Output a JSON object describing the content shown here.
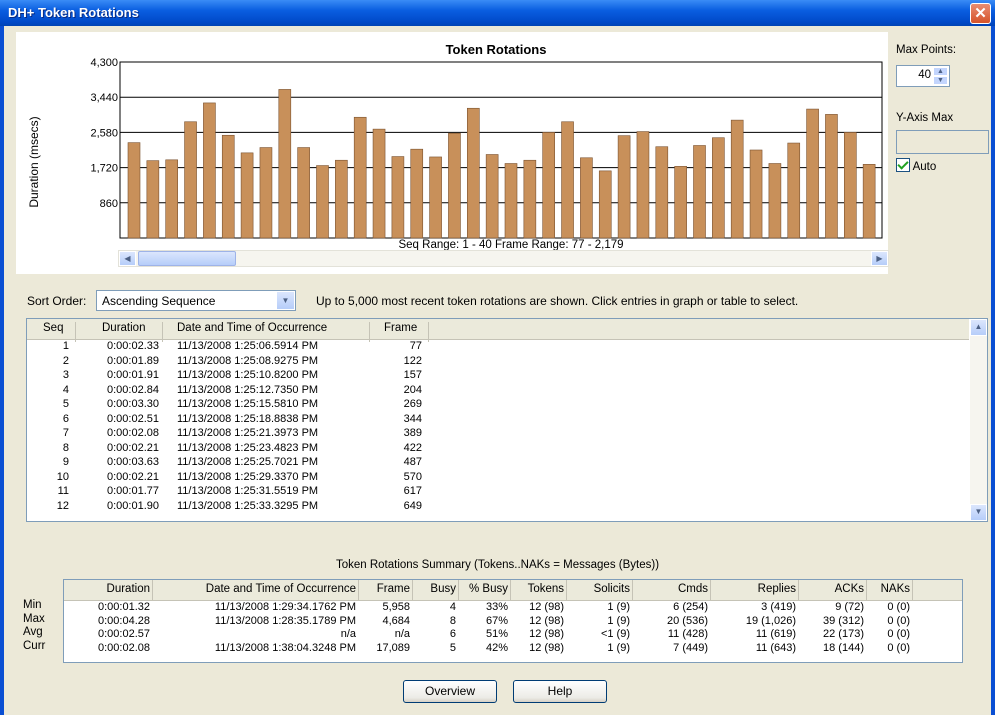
{
  "window": {
    "title": "DH+ Token Rotations",
    "close_glyph": "✕"
  },
  "chart_data": {
    "type": "bar",
    "title": "Token Rotations",
    "ylabel": "Duration (msecs)",
    "xlabel": "",
    "ylim": [
      0,
      4300
    ],
    "yticks": [
      "860",
      "1,720",
      "2,580",
      "3,440",
      "4,300"
    ],
    "ytick_values": [
      860,
      1720,
      2580,
      3440,
      4300
    ],
    "categories": [
      1,
      2,
      3,
      4,
      5,
      6,
      7,
      8,
      9,
      10,
      11,
      12,
      13,
      14,
      15,
      16,
      17,
      18,
      19,
      20,
      21,
      22,
      23,
      24,
      25,
      26,
      27,
      28,
      29,
      30,
      31,
      32,
      33,
      34,
      35,
      36,
      37,
      38,
      39,
      40
    ],
    "values": [
      2330,
      1890,
      1910,
      2840,
      3300,
      2510,
      2080,
      2210,
      3630,
      2210,
      1770,
      1900,
      2950,
      2660,
      1990,
      2170,
      1980,
      2560,
      3170,
      2040,
      1820,
      1900,
      2580,
      2840,
      1960,
      1640,
      2500,
      2600,
      2230,
      1750,
      2260,
      2450,
      2880,
      2150,
      1820,
      2320,
      3150,
      3020,
      2580,
      1800
    ],
    "grid": true,
    "bar_color": "#c8905a",
    "range_label": "Seq Range:  1 - 40     Frame Range:  77 - 2,179"
  },
  "controls": {
    "max_points_label": "Max Points:",
    "max_points_value": "40",
    "y_axis_max_label": "Y-Axis Max",
    "y_axis_max_value": "",
    "auto_label": "Auto",
    "auto_checked": true
  },
  "sort": {
    "label": "Sort Order:",
    "value": "Ascending Sequence",
    "note": "Up to 5,000 most recent token rotations are shown.  Click entries in graph or table to select."
  },
  "rotations_table": {
    "headers": [
      "Seq",
      "Duration",
      "Date and Time of Occurrence",
      "Frame"
    ],
    "rows": [
      [
        "1",
        "0:00:02.33",
        "11/13/2008 1:25:06.5914 PM",
        "77"
      ],
      [
        "2",
        "0:00:01.89",
        "11/13/2008 1:25:08.9275 PM",
        "122"
      ],
      [
        "3",
        "0:00:01.91",
        "11/13/2008 1:25:10.8200 PM",
        "157"
      ],
      [
        "4",
        "0:00:02.84",
        "11/13/2008 1:25:12.7350 PM",
        "204"
      ],
      [
        "5",
        "0:00:03.30",
        "11/13/2008 1:25:15.5810 PM",
        "269"
      ],
      [
        "6",
        "0:00:02.51",
        "11/13/2008 1:25:18.8838 PM",
        "344"
      ],
      [
        "7",
        "0:00:02.08",
        "11/13/2008 1:25:21.3973 PM",
        "389"
      ],
      [
        "8",
        "0:00:02.21",
        "11/13/2008 1:25:23.4823 PM",
        "422"
      ],
      [
        "9",
        "0:00:03.63",
        "11/13/2008 1:25:25.7021 PM",
        "487"
      ],
      [
        "10",
        "0:00:02.21",
        "11/13/2008 1:25:29.3370 PM",
        "570"
      ],
      [
        "11",
        "0:00:01.77",
        "11/13/2008 1:25:31.5519 PM",
        "617"
      ],
      [
        "12",
        "0:00:01.90",
        "11/13/2008 1:25:33.3295 PM",
        "649"
      ]
    ]
  },
  "summary": {
    "title": "Token Rotations Summary   (Tokens..NAKs = Messages (Bytes))",
    "headers": [
      "Duration",
      "Date and Time of Occurrence",
      "Frame",
      "Busy",
      "% Busy",
      "Tokens",
      "Solicits",
      "Cmds",
      "Replies",
      "ACKs",
      "NAKs"
    ],
    "rows": [
      {
        "label": "Min",
        "cells": [
          "0:00:01.32",
          "11/13/2008 1:29:34.1762 PM",
          "5,958",
          "4",
          "33%",
          "12 (98)",
          "1 (9)",
          "6 (254)",
          "3 (419)",
          "9 (72)",
          "0 (0)"
        ]
      },
      {
        "label": "Max",
        "cells": [
          "0:00:04.28",
          "11/13/2008 1:28:35.1789 PM",
          "4,684",
          "8",
          "67%",
          "12 (98)",
          "1 (9)",
          "20 (536)",
          "19 (1,026)",
          "39 (312)",
          "0 (0)"
        ]
      },
      {
        "label": "Avg",
        "cells": [
          "0:00:02.57",
          "n/a",
          "n/a",
          "6",
          "51%",
          "12 (98)",
          "<1 (9)",
          "11 (428)",
          "11 (619)",
          "22 (173)",
          "0 (0)"
        ]
      },
      {
        "label": "Curr",
        "cells": [
          "0:00:02.08",
          "11/13/2008 1:38:04.3248 PM",
          "17,089",
          "5",
          "42%",
          "12 (98)",
          "1 (9)",
          "7 (449)",
          "11 (643)",
          "18 (144)",
          "0 (0)"
        ]
      }
    ]
  },
  "buttons": {
    "overview": "Overview",
    "help": "Help"
  }
}
